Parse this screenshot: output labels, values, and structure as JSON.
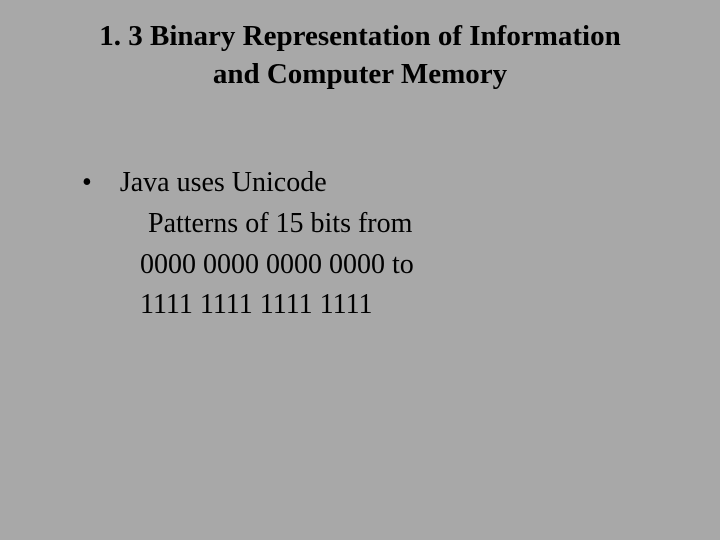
{
  "slide": {
    "title_line1": "1. 3  Binary Representation of Information",
    "title_line2": "and Computer Memory",
    "bullet_marker": "•",
    "bullet_text": "Java uses Unicode",
    "line1": "Patterns of 15 bits from",
    "line2": "0000 0000 0000 0000 to",
    "line3": "1111 1111 1111 1111"
  }
}
